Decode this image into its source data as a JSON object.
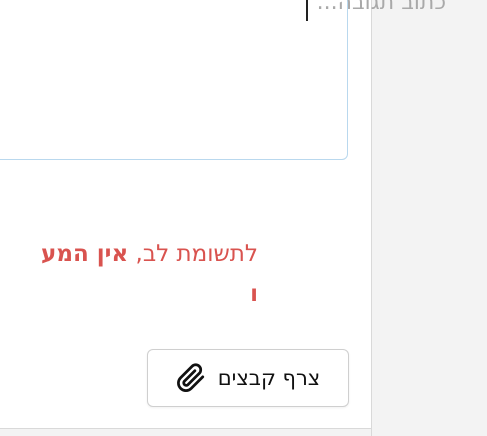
{
  "reply": {
    "placeholder": "כתוב תגובה..."
  },
  "notice": {
    "line1_prefix": "לתשומת לב, ",
    "line1_bold": "אין המע",
    "line2": "ו"
  },
  "attach": {
    "label": "צרף קבצים",
    "icon": "paperclip-icon"
  },
  "colors": {
    "notice_red": "#d9534f",
    "reply_border": "#b9d8ee"
  }
}
